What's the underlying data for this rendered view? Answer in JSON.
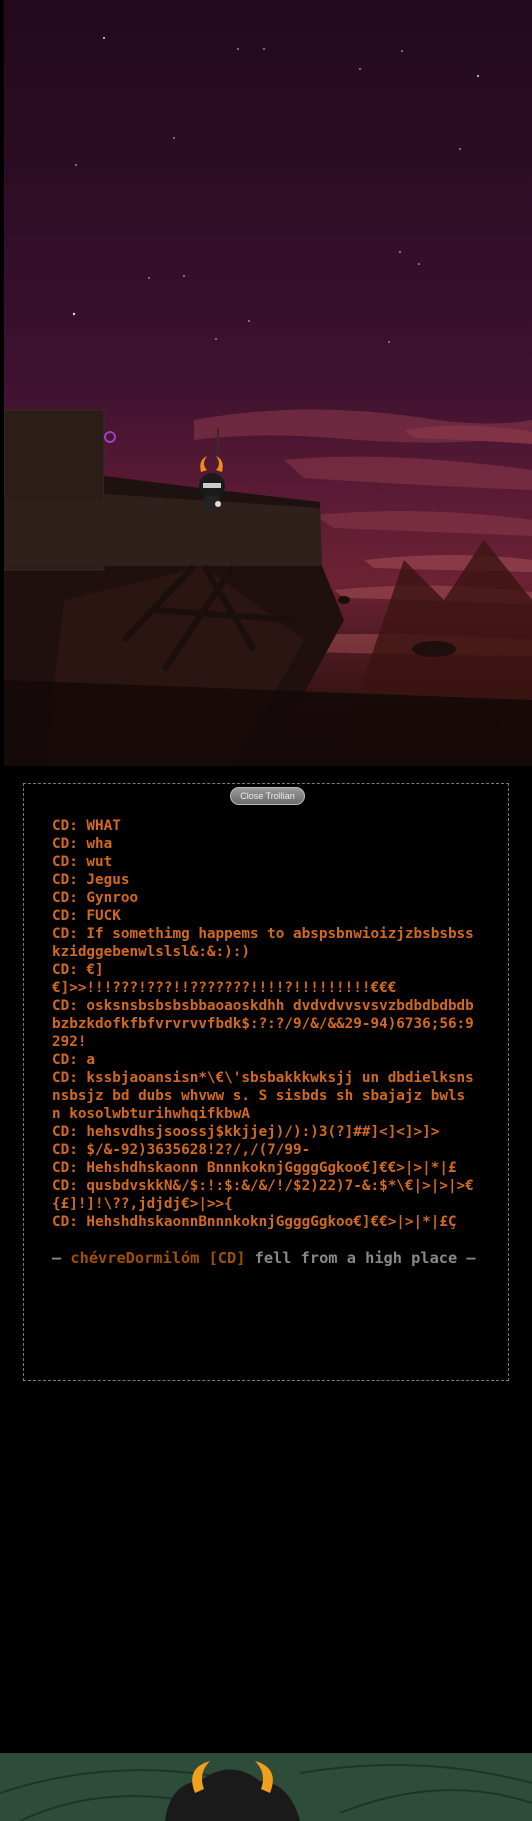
{
  "window": {
    "close_button": "Close Trollian"
  },
  "log": {
    "lines": [
      "CD: WHAT",
      "CD: wha",
      "CD: wut",
      "CD: Jegus",
      "CD: Gynroo",
      "CD: FUCK",
      "CD: If somethimg happems to abspsbnwioizjzbsbsbsskzidggebenwlslsl&:&:):)",
      "CD: €]",
      "€]>>!!!???!???!!???????!!!!?!!!!!!!!!€€€",
      "CD: osksnsbsbsbsbbaoaoskdhh dvdvdvvsvsvzbdbdbdbdbbzbzkdofkfbfvrvrvvfbdk$:?:?/9/&/&&29-94)6736;56:9292!",
      "CD: a",
      "CD: kssbjaoansisn*\\€\\'sbsbakkkwksjj un dbdielksnsnsbsjz bd dubs whvww s. S sisbds sh sbajajz bwls  n kosolwbturihwhqifkbwA",
      "CD: hehsvdhsjsoossj$kkjjej)/):)3(?]##]<]<]>]>",
      "CD: $/&-92)3635628!2?/,/(7/99-",
      "CD: Hehshdhskaonn BnnnkoknjGgggGgkoo€]€€>|>|*|£",
      "CD: qusbdvskkN&/$:!:$:&/&/!/$2)22)7-&:$*\\€|>|>|>€{£]!]!\\??,jdjdj€>|>>{",
      "CD: HehshdhskaonnBnnnkoknjGgggGgkoo€]€€>|>|*|£Ç"
    ],
    "event": {
      "prefix": "— ",
      "handle": "chévreDormilóm [CD]",
      "text": " fell from a high place —"
    }
  },
  "colors": {
    "chat_text": "#d2691e",
    "handle": "#a15000",
    "event_text": "#888888",
    "background": "#000000"
  }
}
